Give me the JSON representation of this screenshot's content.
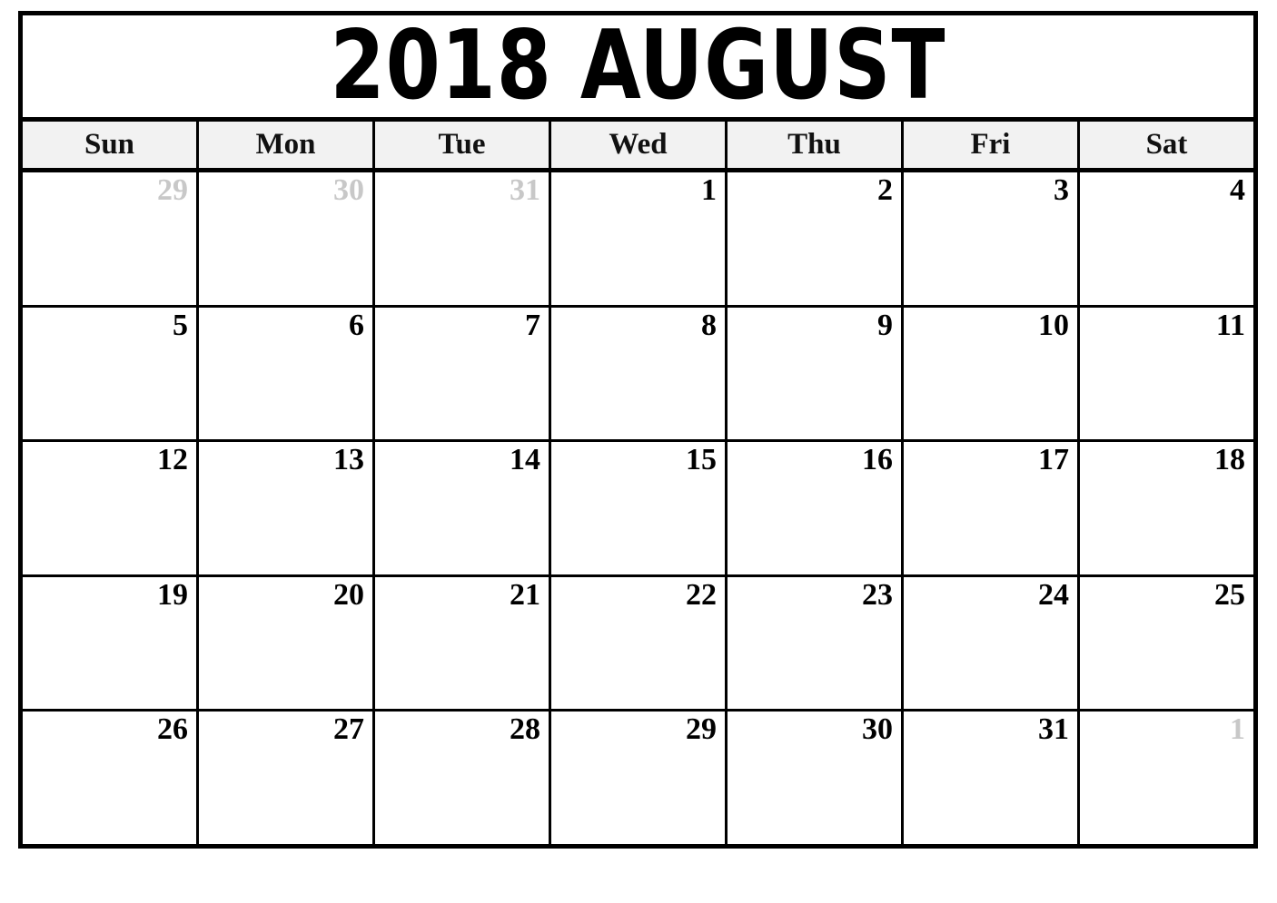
{
  "calendar": {
    "title": "2018 AUGUST",
    "year": "2018",
    "month_name": "AUGUST",
    "weekday_headers": [
      {
        "label": "Sun"
      },
      {
        "label": "Mon"
      },
      {
        "label": "Tue"
      },
      {
        "label": "Wed"
      },
      {
        "label": "Thu"
      },
      {
        "label": "Fri"
      },
      {
        "label": "Sat"
      }
    ],
    "colors": {
      "grid_line": "#000000",
      "header_background": "#f2f2f2",
      "current_month_text": "#000000",
      "adjacent_month_text": "#c8c8c8",
      "cell_background": "#ffffff",
      "page_background": "#ffffff"
    },
    "weeks": [
      {
        "days": [
          {
            "number": "29",
            "adjacent": true
          },
          {
            "number": "30",
            "adjacent": true
          },
          {
            "number": "31",
            "adjacent": true
          },
          {
            "number": "1",
            "adjacent": false
          },
          {
            "number": "2",
            "adjacent": false
          },
          {
            "number": "3",
            "adjacent": false
          },
          {
            "number": "4",
            "adjacent": false
          }
        ]
      },
      {
        "days": [
          {
            "number": "5",
            "adjacent": false
          },
          {
            "number": "6",
            "adjacent": false
          },
          {
            "number": "7",
            "adjacent": false
          },
          {
            "number": "8",
            "adjacent": false
          },
          {
            "number": "9",
            "adjacent": false
          },
          {
            "number": "10",
            "adjacent": false
          },
          {
            "number": "11",
            "adjacent": false
          }
        ]
      },
      {
        "days": [
          {
            "number": "12",
            "adjacent": false
          },
          {
            "number": "13",
            "adjacent": false
          },
          {
            "number": "14",
            "adjacent": false
          },
          {
            "number": "15",
            "adjacent": false
          },
          {
            "number": "16",
            "adjacent": false
          },
          {
            "number": "17",
            "adjacent": false
          },
          {
            "number": "18",
            "adjacent": false
          }
        ]
      },
      {
        "days": [
          {
            "number": "19",
            "adjacent": false
          },
          {
            "number": "20",
            "adjacent": false
          },
          {
            "number": "21",
            "adjacent": false
          },
          {
            "number": "22",
            "adjacent": false
          },
          {
            "number": "23",
            "adjacent": false
          },
          {
            "number": "24",
            "adjacent": false
          },
          {
            "number": "25",
            "adjacent": false
          }
        ]
      },
      {
        "days": [
          {
            "number": "26",
            "adjacent": false
          },
          {
            "number": "27",
            "adjacent": false
          },
          {
            "number": "28",
            "adjacent": false
          },
          {
            "number": "29",
            "adjacent": false
          },
          {
            "number": "30",
            "adjacent": false
          },
          {
            "number": "31",
            "adjacent": false
          },
          {
            "number": "1",
            "adjacent": true
          }
        ]
      }
    ]
  }
}
